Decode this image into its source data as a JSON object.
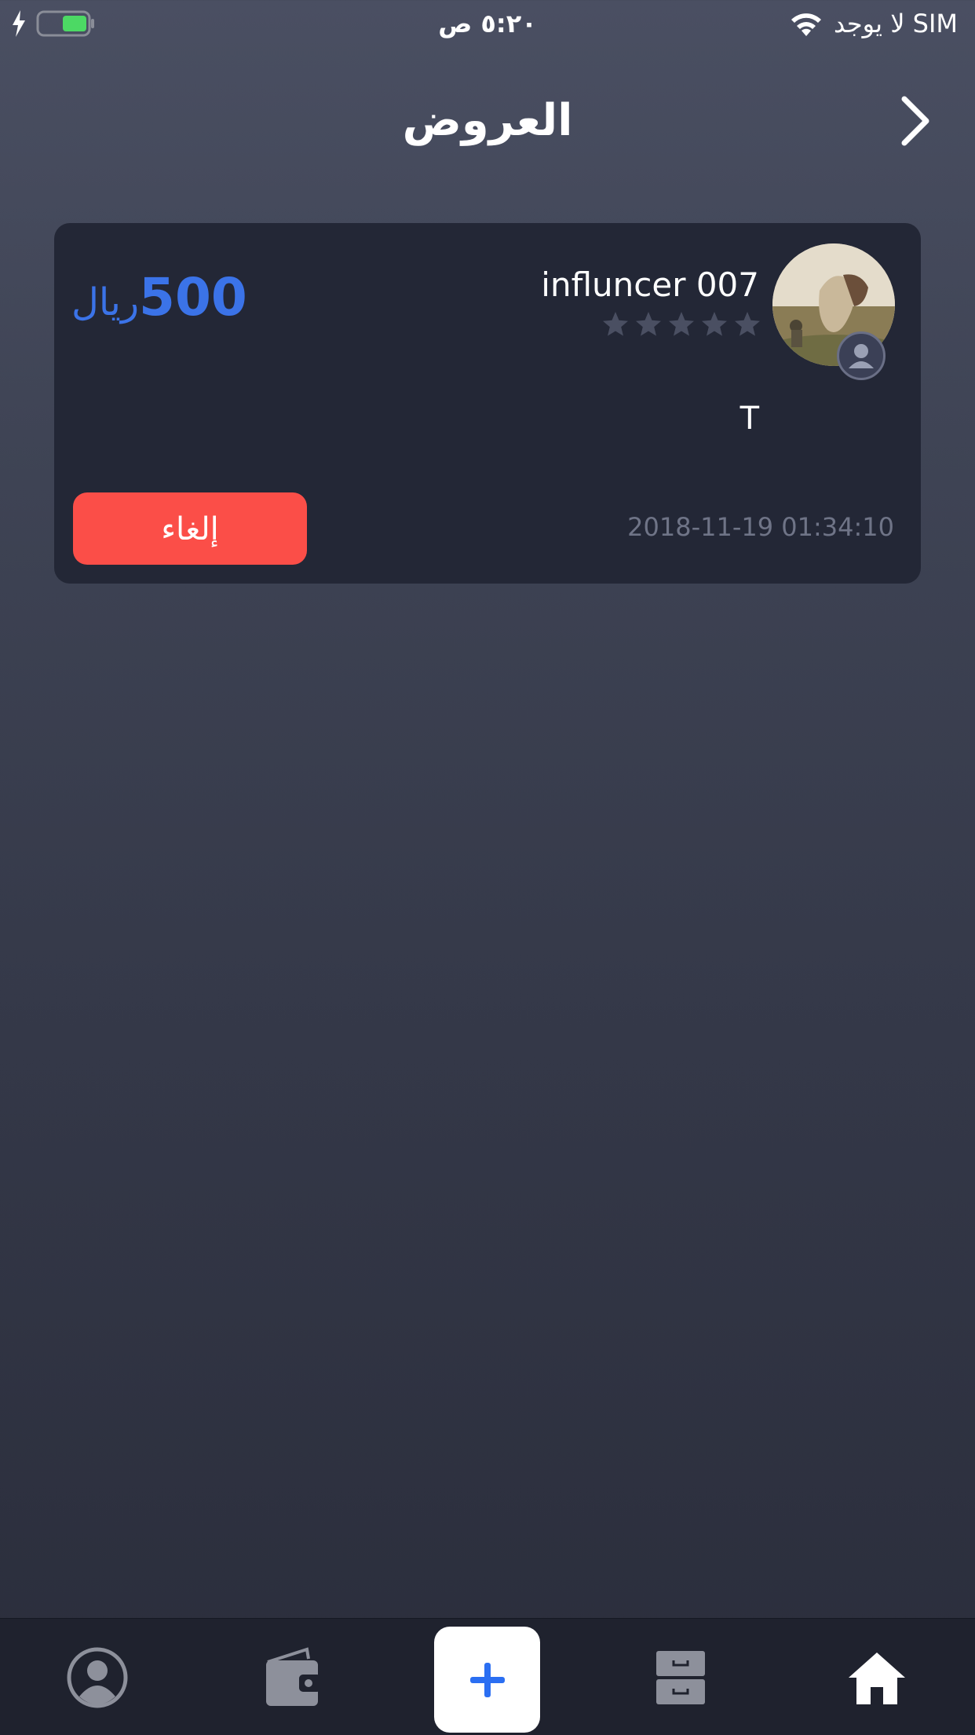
{
  "status_bar": {
    "carrier": "لا يوجد SIM",
    "time": "٥:٢٠ ص",
    "battery_color": "#4cd964"
  },
  "header": {
    "title": "العروض",
    "back_icon": "chevron-right-icon"
  },
  "offer": {
    "influencer_name": "influncer 007",
    "rating": 0,
    "rating_max": 5,
    "price_value": "500",
    "price_currency": "ريال",
    "note": "T",
    "date": "2018-11-19 01:34:10",
    "cancel_label": "إلغاء"
  },
  "tab_bar": {
    "items": [
      {
        "name": "profile",
        "icon": "user-circle-icon"
      },
      {
        "name": "wallet",
        "icon": "wallet-icon"
      },
      {
        "name": "add",
        "icon": "plus-icon"
      },
      {
        "name": "archive",
        "icon": "archive-icon"
      },
      {
        "name": "home",
        "icon": "home-icon",
        "active": true
      }
    ]
  },
  "colors": {
    "accent_blue": "#3b73e8",
    "cancel_red": "#fb4e48",
    "card_bg": "#232736",
    "tab_bar_bg": "#1f222e"
  }
}
